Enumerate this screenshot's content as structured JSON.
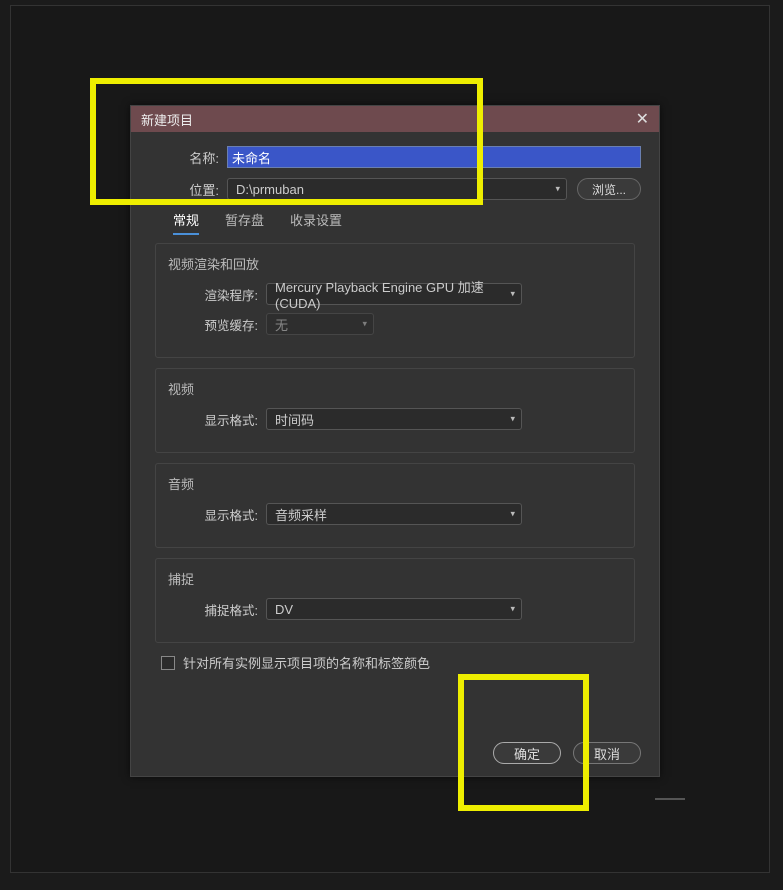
{
  "dialog": {
    "title": "新建项目",
    "name_label": "名称:",
    "name_value": "未命名",
    "location_label": "位置:",
    "location_value": "D:\\prmuban",
    "browse": "浏览..."
  },
  "tabs": {
    "general": "常规",
    "scratch": "暂存盘",
    "ingest": "收录设置"
  },
  "video_render": {
    "section": "视频渲染和回放",
    "renderer_label": "渲染程序:",
    "renderer_value": "Mercury Playback Engine GPU 加速 (CUDA)",
    "cache_label": "预览缓存:",
    "cache_value": "无"
  },
  "video": {
    "section": "视频",
    "format_label": "显示格式:",
    "format_value": "时间码"
  },
  "audio": {
    "section": "音频",
    "format_label": "显示格式:",
    "format_value": "音频采样"
  },
  "capture": {
    "section": "捕捉",
    "format_label": "捕捉格式:",
    "format_value": "DV"
  },
  "checkbox_label": "针对所有实例显示项目项的名称和标签颜色",
  "footer": {
    "ok": "确定",
    "cancel": "取消"
  }
}
